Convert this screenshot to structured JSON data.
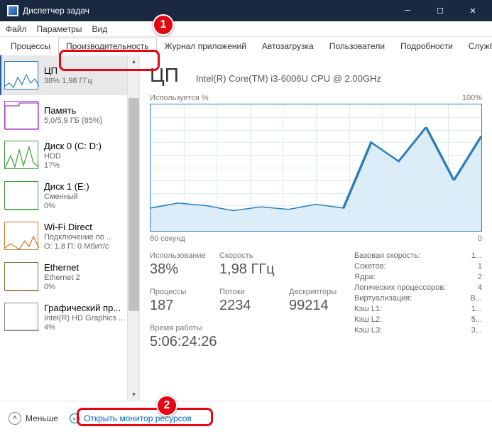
{
  "window": {
    "title": "Диспетчер задач"
  },
  "menu": {
    "file": "Файл",
    "options": "Параметры",
    "view": "Вид"
  },
  "tabs": [
    "Процессы",
    "Производительность",
    "Журнал приложений",
    "Автозагрузка",
    "Пользователи",
    "Подробности",
    "Службы"
  ],
  "sidebar": {
    "items": [
      {
        "title": "ЦП",
        "sub": "38% 1,98 ГГц",
        "color": "#2c7db8",
        "cls": "g-cpu"
      },
      {
        "title": "Память",
        "sub": "5,0/5,9 ГБ (85%)",
        "color": "#a938c7",
        "cls": "g-mem"
      },
      {
        "title": "Диск 0 (C: D:)",
        "sub": "HDD",
        "sub2": "17%",
        "color": "#3a9e3a",
        "cls": "g-disk"
      },
      {
        "title": "Диск 1 (E:)",
        "sub": "Сменный",
        "sub2": "0%",
        "color": "#3a9e3a",
        "cls": "g-disk"
      },
      {
        "title": "Wi-Fi Direct",
        "sub": "Подключение по ...",
        "sub2": "О: 1,8 П: 0 Мбит/с",
        "color": "#c77a2e",
        "cls": "g-wifi"
      },
      {
        "title": "Ethernet",
        "sub": "Ethernet 2",
        "sub2": "0%",
        "color": "#8a6d3b",
        "cls": "g-eth"
      },
      {
        "title": "Графический пр...",
        "sub": "Intel(R) HD Graphics ...",
        "sub2": "4%",
        "color": "#888",
        "cls": "g-gpu"
      }
    ]
  },
  "main": {
    "title": "ЦП",
    "subtitle": "Intel(R) Core(TM) i3-6006U CPU @ 2.00GHz",
    "chart_top_left": "Используется %",
    "chart_top_right": "100%",
    "chart_bottom_left": "60 секунд",
    "chart_bottom_right": "0",
    "stats1": [
      {
        "label": "Использование",
        "value": "38%"
      },
      {
        "label": "Скорость",
        "value": "1,98 ГГц"
      }
    ],
    "stats2": [
      {
        "label": "Процессы",
        "value": "187"
      },
      {
        "label": "Потоки",
        "value": "2234"
      },
      {
        "label": "Дескрипторы",
        "value": "99214"
      }
    ],
    "uptime_label": "Время работы",
    "uptime_value": "5:06:24:26",
    "info": [
      {
        "k": "Базовая скорость:",
        "v": "1..."
      },
      {
        "k": "Сокетов:",
        "v": "1"
      },
      {
        "k": "Ядра:",
        "v": "2"
      },
      {
        "k": "Логических процессоров:",
        "v": "4"
      },
      {
        "k": "Виртуализация:",
        "v": "В..."
      },
      {
        "k": "Кэш L1:",
        "v": "1..."
      },
      {
        "k": "Кэш L2:",
        "v": "5..."
      },
      {
        "k": "Кэш L3:",
        "v": "3..."
      }
    ]
  },
  "footer": {
    "less": "Меньше",
    "monitor": "Открыть монитор ресурсов"
  },
  "chart_data": {
    "type": "area",
    "title": "Используется %",
    "xlabel": "60 секунд",
    "ylabel": "%",
    "ylim": [
      0,
      100
    ],
    "x": [
      0,
      5,
      10,
      15,
      20,
      25,
      30,
      35,
      40,
      45,
      50,
      55,
      60
    ],
    "values": [
      18,
      22,
      20,
      16,
      19,
      17,
      21,
      18,
      70,
      55,
      82,
      40,
      75
    ]
  },
  "annotations": {
    "1": "1",
    "2": "2"
  }
}
